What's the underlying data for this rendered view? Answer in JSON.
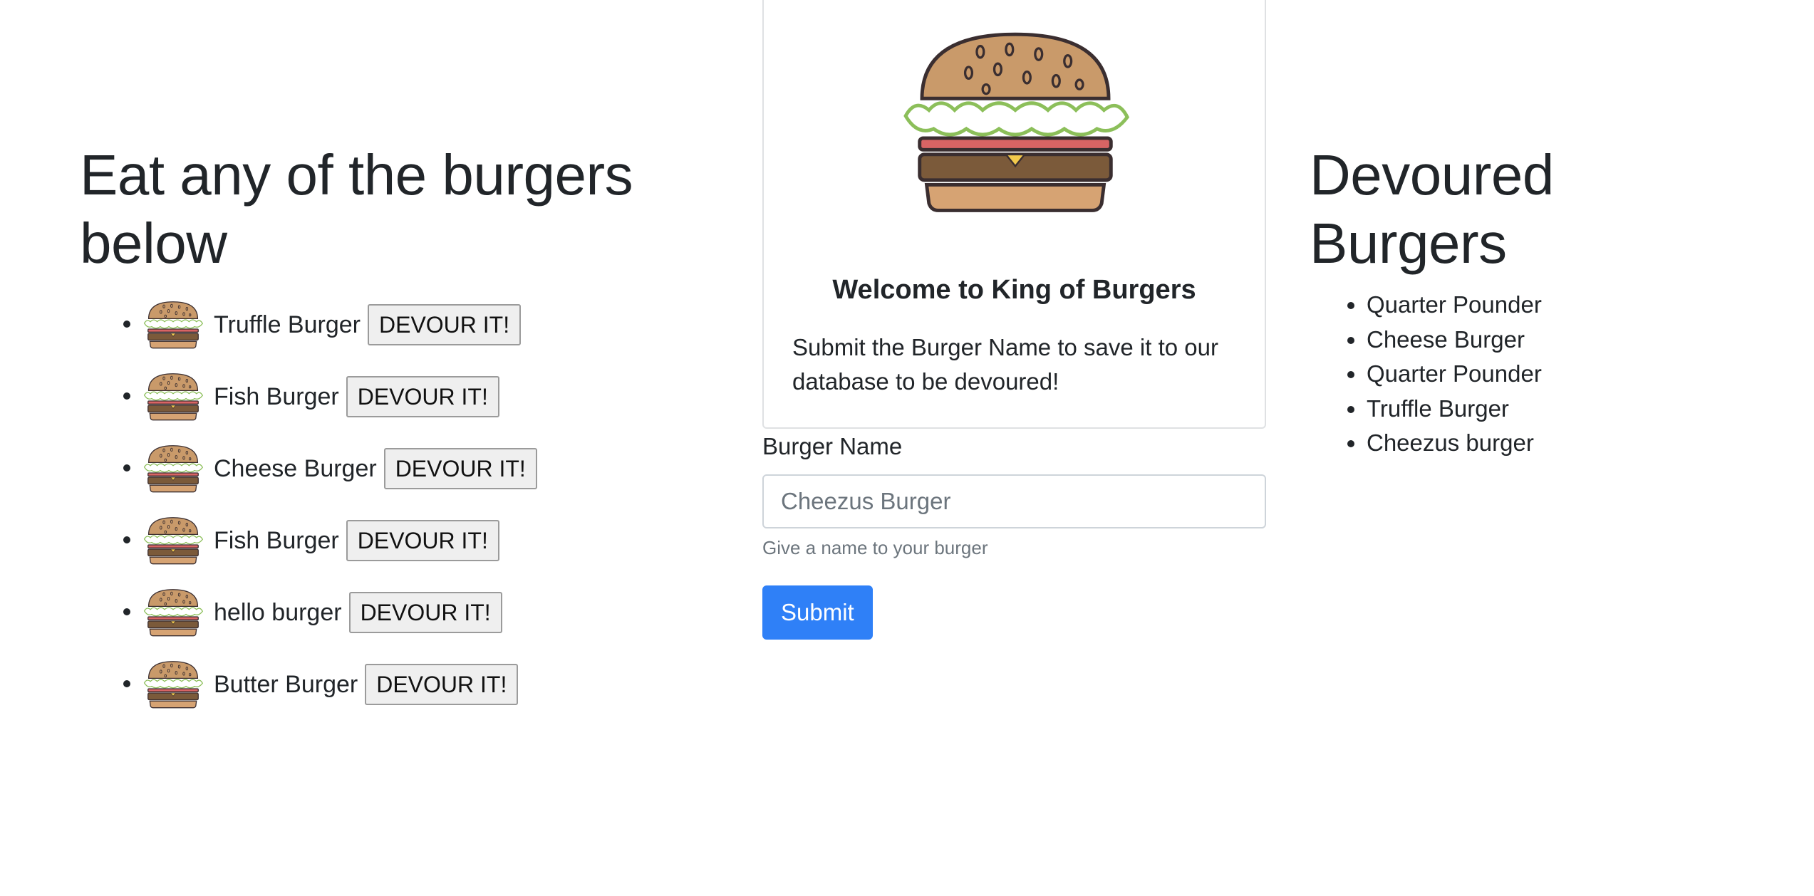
{
  "left": {
    "heading": "Eat any of the burgers below",
    "button_label": "DEVOUR IT!",
    "burgers": [
      {
        "name": "Truffle Burger"
      },
      {
        "name": "Fish Burger"
      },
      {
        "name": "Cheese Burger"
      },
      {
        "name": "Fish Burger"
      },
      {
        "name": "hello burger"
      },
      {
        "name": "Butter Burger"
      }
    ]
  },
  "card": {
    "title": "Welcome to King of Burgers",
    "text": "Submit the Burger Name to save it to our database to be devoured!"
  },
  "form": {
    "label": "Burger Name",
    "placeholder": "Cheezus Burger",
    "help": "Give a name to your burger",
    "submit_label": "Submit"
  },
  "right": {
    "heading": "Devoured Burgers",
    "items": [
      "Quarter Pounder",
      "Cheese Burger",
      "Quarter Pounder",
      "Truffle Burger",
      "Cheezus burger"
    ]
  },
  "colors": {
    "primary": "#2f80f7",
    "text": "#212529",
    "muted": "#6c757d"
  },
  "icons": {
    "burger": "burger-icon"
  }
}
